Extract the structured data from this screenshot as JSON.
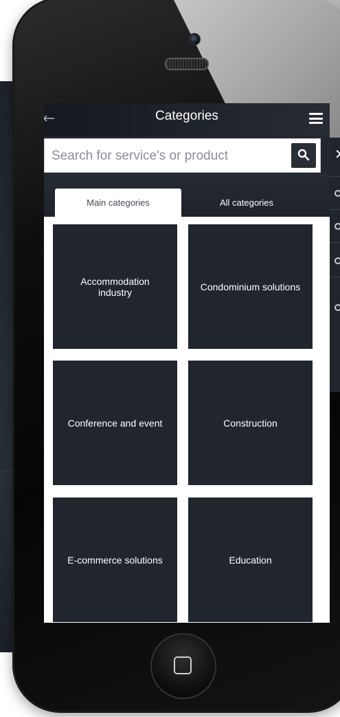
{
  "header": {
    "title": "Categories"
  },
  "search": {
    "placeholder": "Search for service's or product"
  },
  "tabs": [
    {
      "label": "Main categories",
      "active": true
    },
    {
      "label": "All categories",
      "active": false
    }
  ],
  "categories": [
    {
      "label": "Accommodation industry"
    },
    {
      "label": "Condominium solutions"
    },
    {
      "label": "Conference and event"
    },
    {
      "label": "Construction"
    },
    {
      "label": "E-commerce solutions"
    },
    {
      "label": "Education"
    }
  ],
  "colors": {
    "tile": "#21252d",
    "page": "#ffffff",
    "accent": "#2a2e36"
  },
  "icons": {
    "back": "back-arrow-icon",
    "menu": "hamburger-icon",
    "search": "search-icon",
    "close": "close-icon",
    "home": "home-button-icon"
  }
}
